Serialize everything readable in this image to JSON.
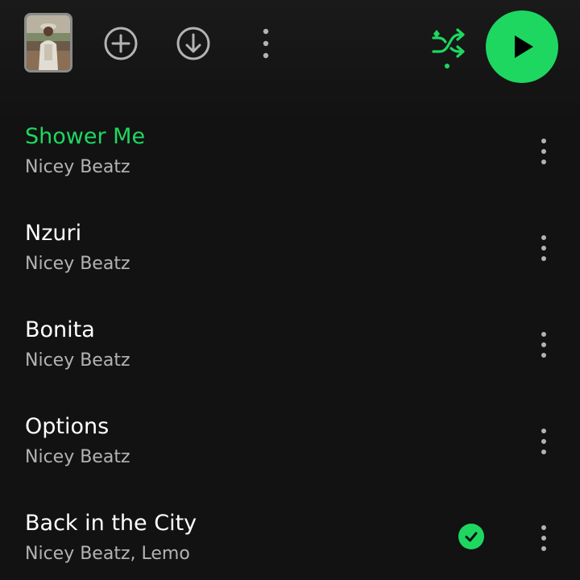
{
  "toolbar": {
    "cover_icon": "album-cover-thumbnail",
    "add_icon": "add-circle-icon",
    "download_icon": "download-circle-icon",
    "more_icon": "more-vertical-icon",
    "shuffle_icon": "smart-shuffle-icon",
    "play_icon": "play-icon",
    "accent_color": "#1ed760"
  },
  "tracks": [
    {
      "title": "Shower Me",
      "artist": "Nicey Beatz",
      "active": true,
      "downloaded": false
    },
    {
      "title": "Nzuri",
      "artist": "Nicey Beatz",
      "active": false,
      "downloaded": false
    },
    {
      "title": "Bonita",
      "artist": "Nicey Beatz",
      "active": false,
      "downloaded": false
    },
    {
      "title": "Options",
      "artist": "Nicey Beatz",
      "active": false,
      "downloaded": false
    },
    {
      "title": "Back in the City",
      "artist": "Nicey Beatz, Lemo",
      "active": false,
      "downloaded": true
    }
  ],
  "colors": {
    "background": "#121212",
    "accent": "#1ed760",
    "secondary_text": "#b3b3b3"
  }
}
